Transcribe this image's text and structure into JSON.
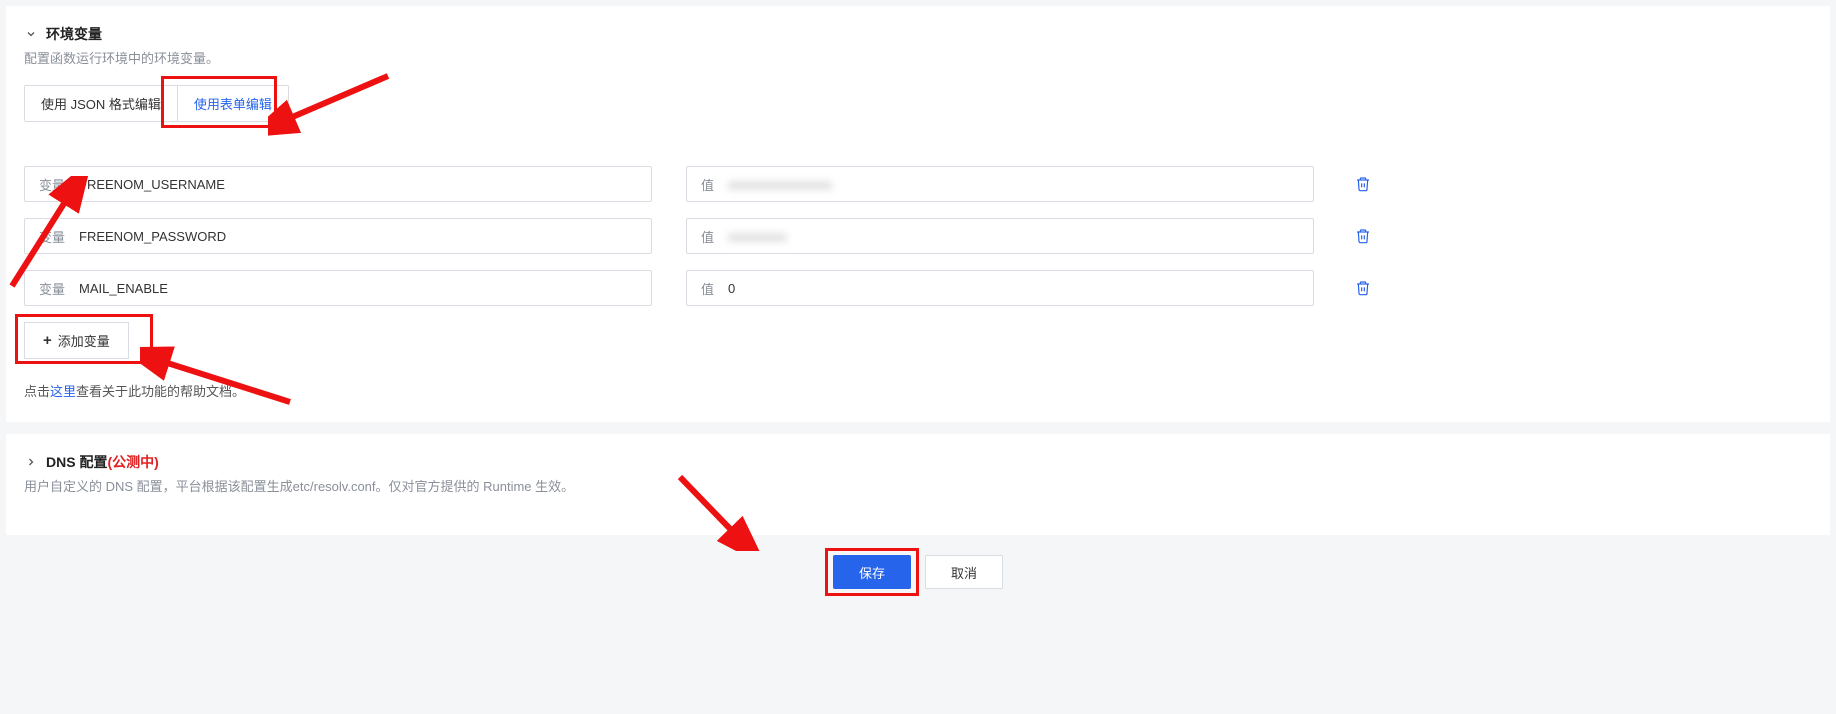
{
  "env": {
    "title": "环境变量",
    "desc": "配置函数运行环境中的环境变量。",
    "tabs": {
      "json": "使用 JSON 格式编辑",
      "form": "使用表单编辑"
    },
    "field_var_label": "变量",
    "field_val_label": "值",
    "rows": [
      {
        "var": "FREENOM_USERNAME",
        "val": "xxxxxxxxxxxxxxxx",
        "blurred": true
      },
      {
        "var": "FREENOM_PASSWORD",
        "val": "xxxxxxxxx",
        "blurred": true
      },
      {
        "var": "MAIL_ENABLE",
        "val": "0",
        "blurred": false
      }
    ],
    "add_btn": "添加变量",
    "help_prefix": "点击",
    "help_link": "这里",
    "help_suffix": "查看关于此功能的帮助文档。"
  },
  "dns": {
    "title": "DNS 配置",
    "beta": "(公测中)",
    "desc": "用户自定义的 DNS 配置，平台根据该配置生成etc/resolv.conf。仅对官方提供的 Runtime 生效。"
  },
  "footer": {
    "save": "保存",
    "cancel": "取消"
  }
}
